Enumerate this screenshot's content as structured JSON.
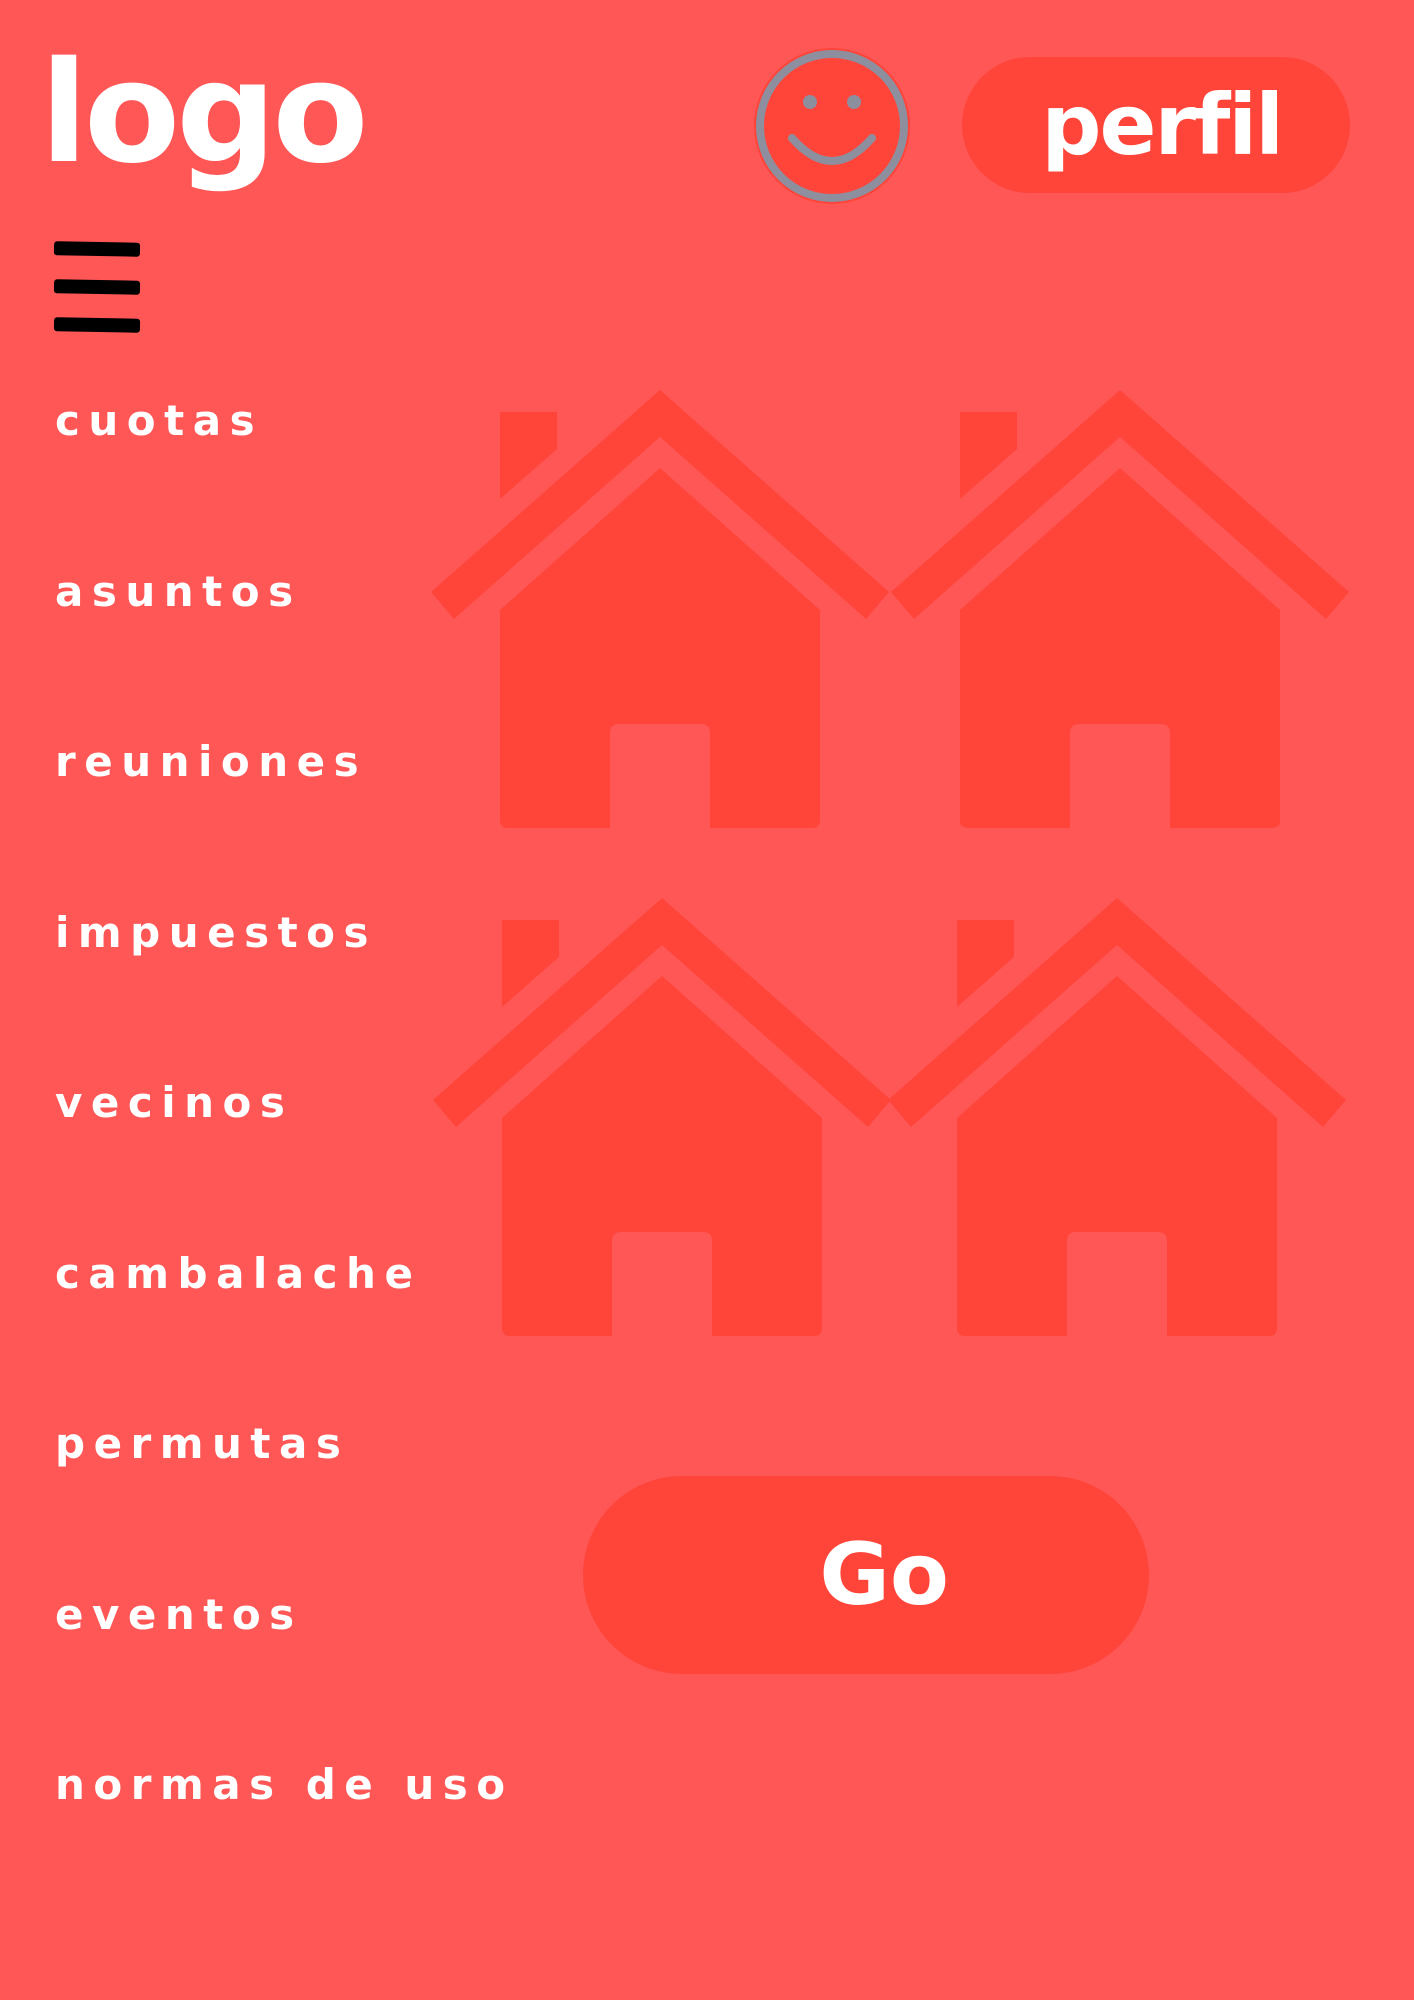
{
  "header": {
    "logo_text": "logo",
    "avatar_icon": "smiley-face-icon",
    "profile_label": "perfil"
  },
  "menu_icon": "hamburger-menu-icon",
  "nav": {
    "items": [
      {
        "label": "cuotas"
      },
      {
        "label": "asuntos"
      },
      {
        "label": "reuniones"
      },
      {
        "label": "impuestos"
      },
      {
        "label": "vecinos"
      },
      {
        "label": "cambalache"
      },
      {
        "label": "permutas"
      },
      {
        "label": "eventos"
      },
      {
        "label": "normas de uso"
      }
    ]
  },
  "illustration": {
    "icon": "houses-icon"
  },
  "go_button_label": "Go",
  "colors": {
    "background": "#ff5656",
    "accent": "#ff453a",
    "text": "#ffffff",
    "avatar_stroke": "#8e8f9e"
  }
}
